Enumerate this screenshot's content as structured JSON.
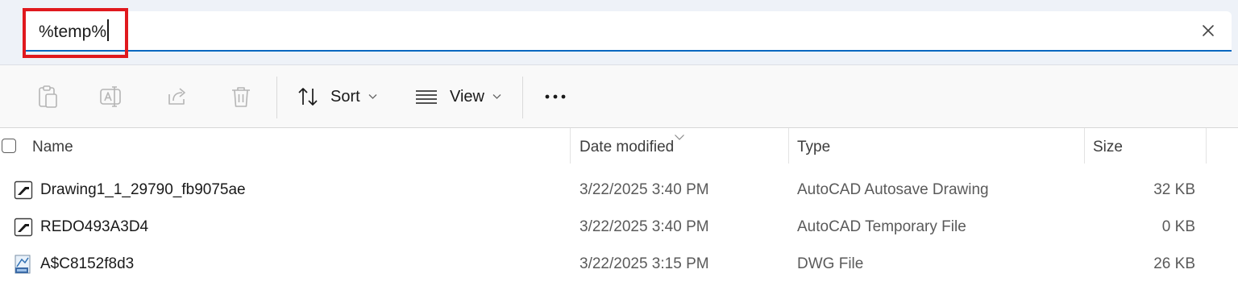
{
  "address_bar": {
    "value": "%temp%",
    "clear_icon": "close-icon"
  },
  "toolbar": {
    "copy_icon": "clipboard-icon",
    "rename_icon": "rename-icon",
    "share_icon": "share-icon",
    "delete_icon": "trash-icon",
    "sort_label": "Sort",
    "view_label": "View",
    "more_icon": "more-icon"
  },
  "columns": {
    "name": "Name",
    "date_modified": "Date modified",
    "type": "Type",
    "size": "Size"
  },
  "files": [
    {
      "name": "Drawing1_1_29790_fb9075ae",
      "date_modified": "3/22/2025 3:40 PM",
      "type": "AutoCAD Autosave Drawing",
      "size": "32 KB",
      "icon": "autocad-file-icon"
    },
    {
      "name": "REDO493A3D4",
      "date_modified": "3/22/2025 3:40 PM",
      "type": "AutoCAD Temporary File",
      "size": "0 KB",
      "icon": "autocad-file-icon"
    },
    {
      "name": "A$C8152f8d3",
      "date_modified": "3/22/2025 3:15 PM",
      "type": "DWG File",
      "size": "26 KB",
      "icon": "dwg-file-icon"
    }
  ],
  "colors": {
    "accent": "#0067c0",
    "highlight": "#e0191e"
  }
}
